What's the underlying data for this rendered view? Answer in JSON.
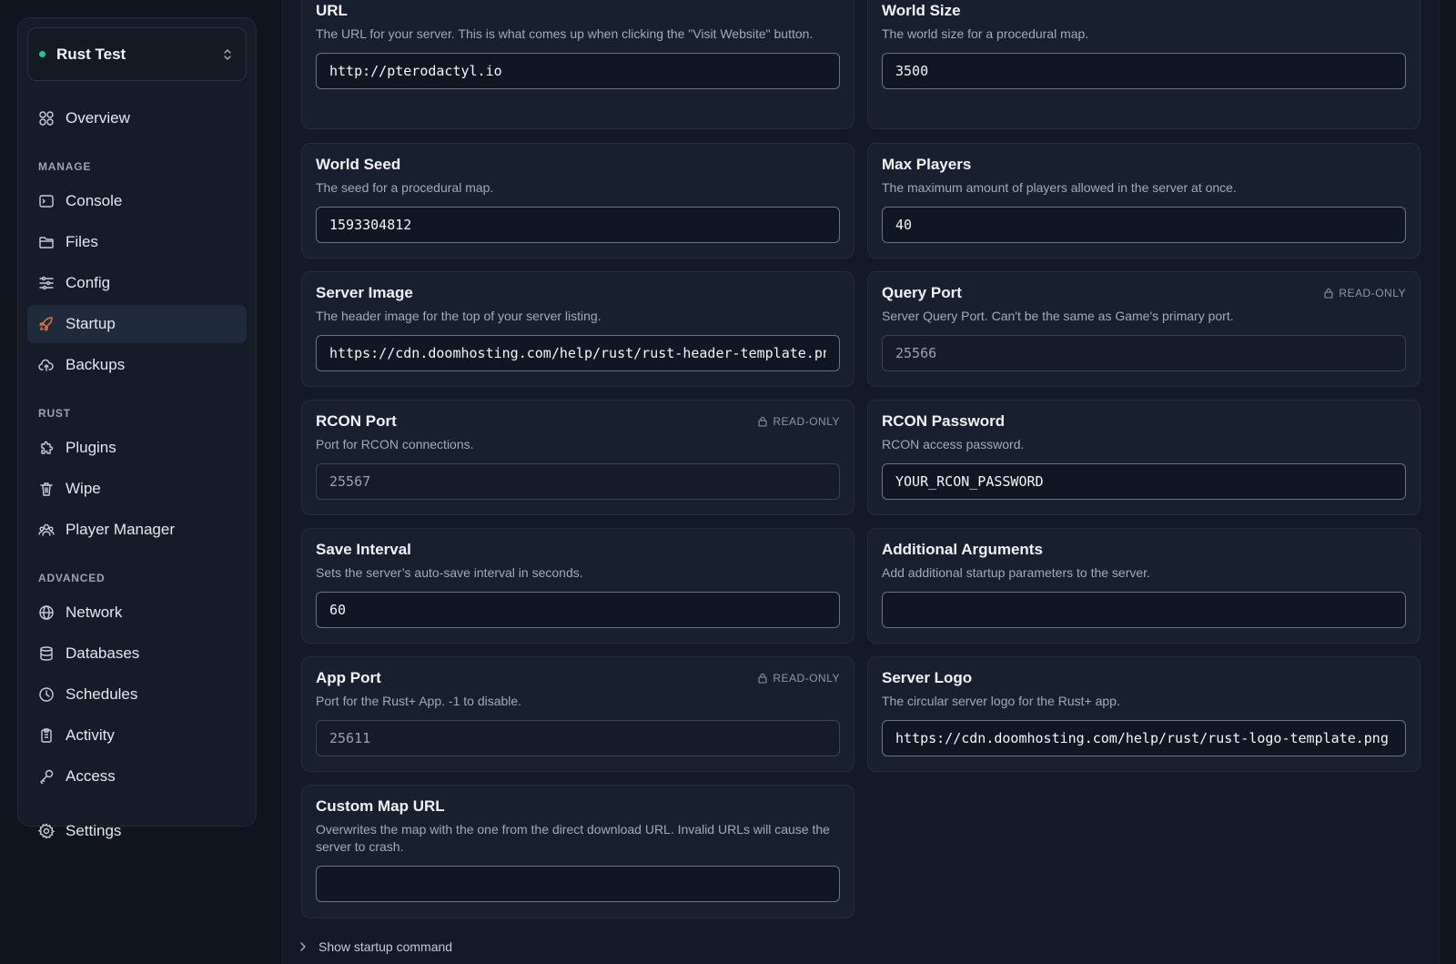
{
  "server": {
    "name": "Rust Test",
    "status_color": "#22c48d"
  },
  "nav": {
    "overview": "Overview",
    "manage_label": "MANAGE",
    "console": "Console",
    "files": "Files",
    "config": "Config",
    "startup": "Startup",
    "backups": "Backups",
    "rust_label": "RUST",
    "plugins": "Plugins",
    "wipe": "Wipe",
    "player_manager": "Player Manager",
    "advanced_label": "ADVANCED",
    "network": "Network",
    "databases": "Databases",
    "schedules": "Schedules",
    "activity": "Activity",
    "access": "Access",
    "settings": "Settings",
    "active_item": "Startup"
  },
  "readonly_label": "READ-ONLY",
  "variables": {
    "url": {
      "title": "URL",
      "desc": "The URL for your server. This is what comes up when clicking the \"Visit Website\" button.",
      "value": "http://pterodactyl.io"
    },
    "world_size": {
      "title": "World Size",
      "desc": "The world size for a procedural map.",
      "value": "3500"
    },
    "world_seed": {
      "title": "World Seed",
      "desc": "The seed for a procedural map.",
      "value": "1593304812"
    },
    "max_players": {
      "title": "Max Players",
      "desc": "The maximum amount of players allowed in the server at once.",
      "value": "40"
    },
    "server_image": {
      "title": "Server Image",
      "desc": "The header image for the top of your server listing.",
      "value": "https://cdn.doomhosting.com/help/rust/rust-header-template.png"
    },
    "query_port": {
      "title": "Query Port",
      "desc": "Server Query Port. Can't be the same as Game's primary port.",
      "value": "25566"
    },
    "rcon_port": {
      "title": "RCON Port",
      "desc": "Port for RCON connections.",
      "value": "25567"
    },
    "rcon_password": {
      "title": "RCON Password",
      "desc": "RCON access password.",
      "value": "YOUR_RCON_PASSWORD"
    },
    "save_interval": {
      "title": "Save Interval",
      "desc": "Sets the server’s auto-save interval in seconds.",
      "value": "60"
    },
    "additional_args": {
      "title": "Additional Arguments",
      "desc": "Add additional startup parameters to the server.",
      "value": ""
    },
    "app_port": {
      "title": "App Port",
      "desc": "Port for the Rust+ App. -1 to disable.",
      "value": "25611"
    },
    "server_logo": {
      "title": "Server Logo",
      "desc": "The circular server logo for the Rust+ app.",
      "value": "https://cdn.doomhosting.com/help/rust/rust-logo-template.png"
    },
    "custom_map_url": {
      "title": "Custom Map URL",
      "desc": "Overwrites the map with the one from the direct download URL. Invalid URLs will cause the server to crash.",
      "value": ""
    }
  },
  "show_startup_command": "Show startup command"
}
